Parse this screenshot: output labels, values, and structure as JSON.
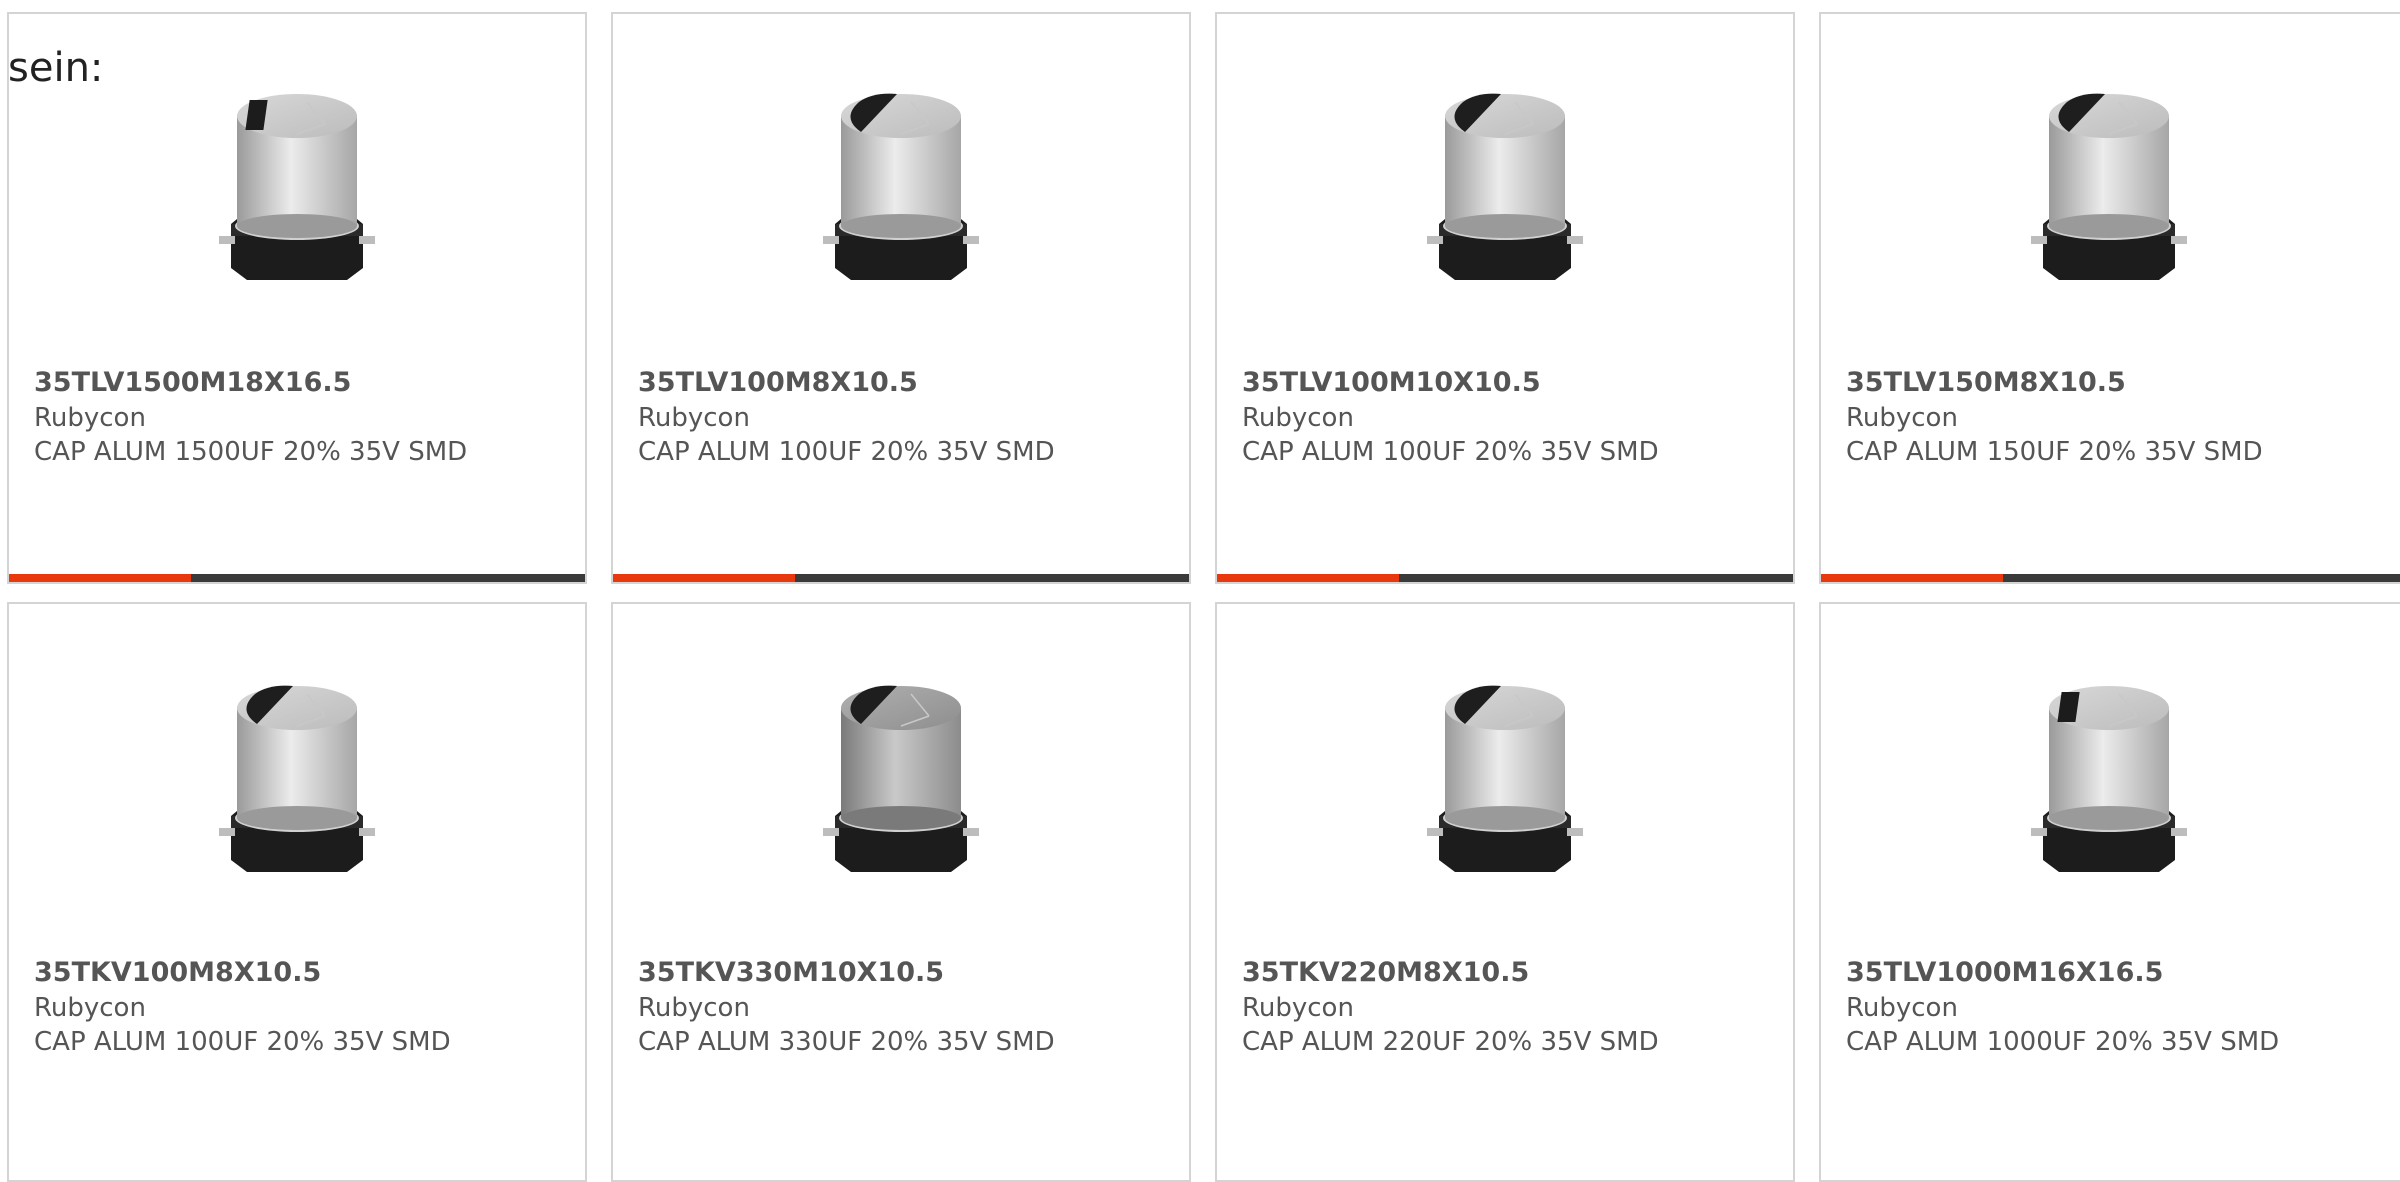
{
  "intro_text": "sein:",
  "accent_color": "#e8380e",
  "bar_color": "#3a3a3a",
  "products": [
    {
      "part": "35TLV1500M18X16.5",
      "maker": "Rubycon",
      "desc": "CAP ALUM 1500UF 20% 35V SMD",
      "image": "capacitor-image-flat-marking"
    },
    {
      "part": "35TLV100M8X10.5",
      "maker": "Rubycon",
      "desc": "CAP ALUM 100UF 20% 35V SMD",
      "image": "capacitor-image"
    },
    {
      "part": "35TLV100M10X10.5",
      "maker": "Rubycon",
      "desc": "CAP ALUM 100UF 20% 35V SMD",
      "image": "capacitor-image"
    },
    {
      "part": "35TLV150M8X10.5",
      "maker": "Rubycon",
      "desc": "CAP ALUM 150UF 20% 35V SMD",
      "image": "capacitor-image"
    },
    {
      "part": "35TKV100M8X10.5",
      "maker": "Rubycon",
      "desc": "CAP ALUM 100UF 20% 35V SMD",
      "image": "capacitor-image"
    },
    {
      "part": "35TKV330M10X10.5",
      "maker": "Rubycon",
      "desc": "CAP ALUM 330UF 20% 35V SMD",
      "image": "capacitor-image-dark"
    },
    {
      "part": "35TKV220M8X10.5",
      "maker": "Rubycon",
      "desc": "CAP ALUM 220UF 20% 35V SMD",
      "image": "capacitor-image"
    },
    {
      "part": "35TLV1000M16X16.5",
      "maker": "Rubycon",
      "desc": "CAP ALUM 1000UF 20% 35V SMD",
      "image": "capacitor-image-flat-marking"
    }
  ]
}
